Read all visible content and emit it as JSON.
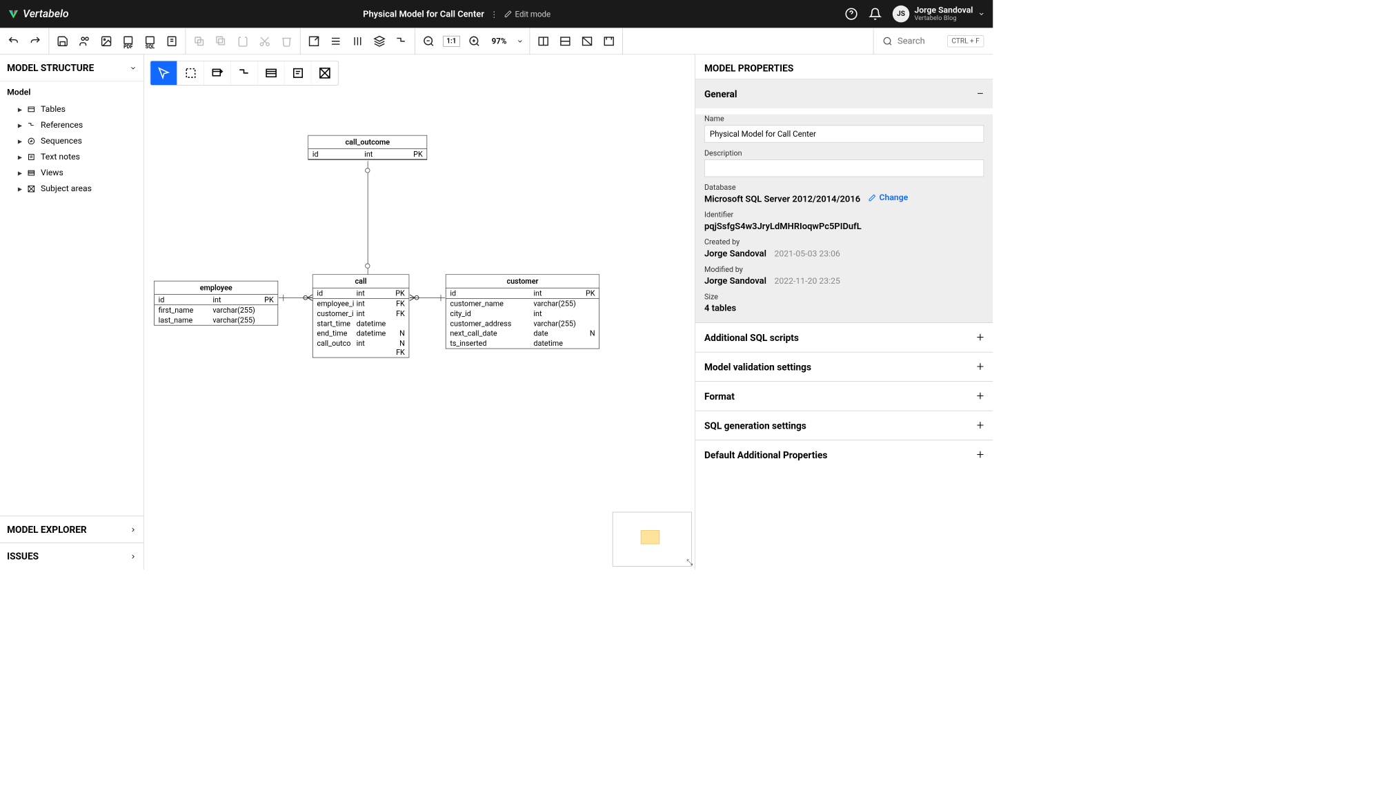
{
  "header": {
    "brand": "Vertabelo",
    "model_title": "Physical Model for Call Center",
    "edit_mode": "Edit mode",
    "user_initials": "JS",
    "user_name": "Jorge Sandoval",
    "user_sub": "Vertabelo Blog"
  },
  "toolbar": {
    "zoom_fit": "1:1",
    "zoom_value": "97%",
    "search_placeholder": "Search",
    "search_hint": "CTRL + F"
  },
  "left": {
    "title": "MODEL STRUCTURE",
    "root": "Model",
    "items": [
      {
        "label": "Tables"
      },
      {
        "label": "References"
      },
      {
        "label": "Sequences"
      },
      {
        "label": "Text notes"
      },
      {
        "label": "Views"
      },
      {
        "label": "Subject areas"
      }
    ],
    "explorer": "MODEL EXPLORER",
    "issues": "ISSUES"
  },
  "entities": {
    "call_outcome": {
      "name": "call_outcome",
      "rows": [
        {
          "name": "id",
          "type": "int",
          "key": "PK",
          "pk": true
        }
      ]
    },
    "employee": {
      "name": "employee",
      "rows": [
        {
          "name": "id",
          "type": "int",
          "key": "PK",
          "pk": true
        },
        {
          "name": "first_name",
          "type": "varchar(255)",
          "key": ""
        },
        {
          "name": "last_name",
          "type": "varchar(255)",
          "key": ""
        }
      ]
    },
    "call": {
      "name": "call",
      "rows": [
        {
          "name": "id",
          "type": "int",
          "key": "PK",
          "pk": true
        },
        {
          "name": "employee_i",
          "type": "int",
          "key": "FK"
        },
        {
          "name": "customer_i",
          "type": "int",
          "key": "FK"
        },
        {
          "name": "start_time",
          "type": "datetime",
          "key": ""
        },
        {
          "name": "end_time",
          "type": "datetime",
          "key": "N"
        },
        {
          "name": "call_outco",
          "type": "int",
          "key": "N FK"
        }
      ]
    },
    "customer": {
      "name": "customer",
      "rows": [
        {
          "name": "id",
          "type": "int",
          "key": "PK",
          "pk": true
        },
        {
          "name": "customer_name",
          "type": "varchar(255)",
          "key": ""
        },
        {
          "name": "city_id",
          "type": "int",
          "key": ""
        },
        {
          "name": "customer_address",
          "type": "varchar(255)",
          "key": ""
        },
        {
          "name": "next_call_date",
          "type": "date",
          "key": "N"
        },
        {
          "name": "ts_inserted",
          "type": "datetime",
          "key": ""
        }
      ]
    }
  },
  "right": {
    "title": "MODEL PROPERTIES",
    "general": "General",
    "name_label": "Name",
    "name_value": "Physical Model for Call Center",
    "desc_label": "Description",
    "desc_value": "",
    "db_label": "Database",
    "db_value": "Microsoft SQL Server 2012/2014/2016",
    "change": "Change",
    "id_label": "Identifier",
    "id_value": "pqjSsfgS4w3JryLdMHRIoqwPc5PIDufL",
    "created_label": "Created by",
    "created_by": "Jorge Sandoval",
    "created_at": "2021-05-03 23:06",
    "modified_label": "Modified by",
    "modified_by": "Jorge Sandoval",
    "modified_at": "2022-11-20 23:25",
    "size_label": "Size",
    "size_value": "4 tables",
    "sections": [
      "Additional SQL scripts",
      "Model validation settings",
      "Format",
      "SQL generation settings",
      "Default Additional Properties"
    ]
  }
}
